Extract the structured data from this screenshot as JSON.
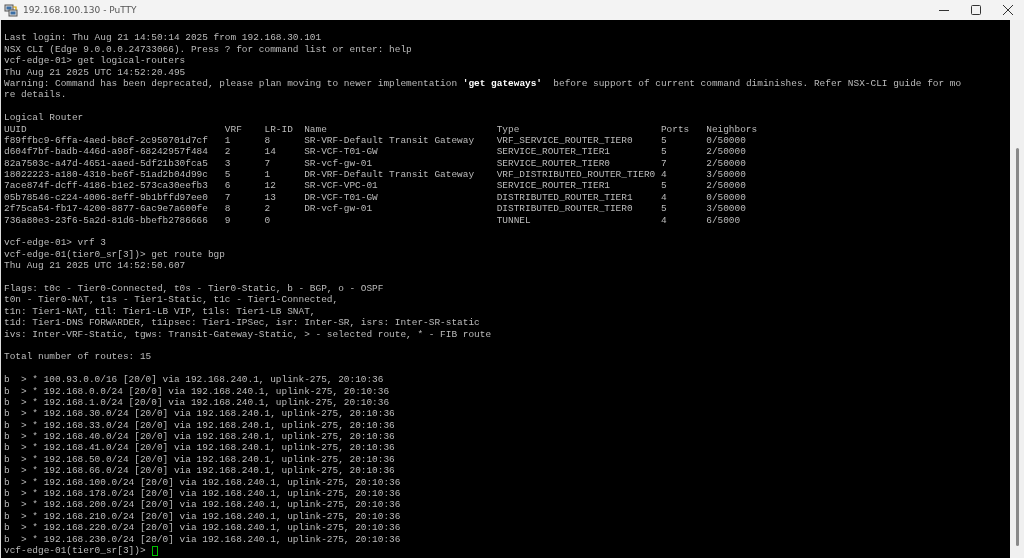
{
  "window": {
    "title": "192.168.100.130 - PuTTY"
  },
  "terminal": {
    "lines_before": [
      {
        "kind": "blank"
      },
      {
        "kind": "text",
        "text": "Last login: Thu Aug 21 14:50:14 2025 from 192.168.30.101"
      },
      {
        "kind": "text",
        "text": "NSX CLI (Edge 9.0.0.0.24733066). Press ? for command list or enter: help"
      },
      {
        "kind": "text",
        "text": "vcf-edge-01> get logical-routers"
      },
      {
        "kind": "text",
        "text": "Thu Aug 21 2025 UTC 14:52:20.495"
      },
      {
        "kind": "text",
        "text": "Warning: Command has been deprecated, please plan moving to newer implementation **'get gateways'**  before support of current command diminishes. Refer NSX-CLI guide for mo"
      },
      {
        "kind": "text",
        "text": "re details."
      },
      {
        "kind": "blank"
      },
      {
        "kind": "text",
        "text": "Logical Router"
      }
    ],
    "table": {
      "columns": [
        "UUID",
        "VRF",
        "LR-ID",
        "Name",
        "Type",
        "Ports",
        "Neighbors"
      ],
      "rows": [
        [
          "f89ffbc9-6ffa-4aed-b8cf-2c950701d7cf",
          "1",
          "8",
          "SR-VRF-Default Transit Gateway",
          "VRF_SERVICE_ROUTER_TIER0",
          "5",
          "0/50000"
        ],
        [
          "d604f7bf-badb-446d-a98f-68242957f484",
          "2",
          "14",
          "SR-VCF-T01-GW",
          "SERVICE_ROUTER_TIER1",
          "5",
          "2/50000"
        ],
        [
          "82a7503c-a47d-4651-aaed-5df21b30fca5",
          "3",
          "7",
          "SR-vcf-gw-01",
          "SERVICE_ROUTER_TIER0",
          "7",
          "2/50000"
        ],
        [
          "18022223-a180-4310-be6f-51ad2b04d99c",
          "5",
          "1",
          "DR-VRF-Default Transit Gateway",
          "VRF_DISTRIBUTED_ROUTER_TIER0",
          "4",
          "3/50000"
        ],
        [
          "7ace874f-dcff-4186-b1e2-573ca30eefb3",
          "6",
          "12",
          "SR-VCF-VPC-01",
          "SERVICE_ROUTER_TIER1",
          "5",
          "2/50000"
        ],
        [
          "05b78546-c224-4006-8eff-9b1bffd97ee0",
          "7",
          "13",
          "DR-VCF-T01-GW",
          "DISTRIBUTED_ROUTER_TIER1",
          "4",
          "0/50000"
        ],
        [
          "2f75ca54-fb17-4200-8877-6ac9e7a600fe",
          "8",
          "2",
          "DR-vcf-gw-01",
          "DISTRIBUTED_ROUTER_TIER0",
          "5",
          "3/50000"
        ],
        [
          "736a80e3-23f6-5a2d-81d6-bbefb2786666",
          "9",
          "0",
          "",
          "TUNNEL",
          "4",
          "6/5000"
        ]
      ]
    },
    "lines_after": [
      {
        "kind": "blank"
      },
      {
        "kind": "text",
        "text": "vcf-edge-01> vrf 3"
      },
      {
        "kind": "text",
        "text": "vcf-edge-01(tier0_sr[3])> get route bgp"
      },
      {
        "kind": "text",
        "text": "Thu Aug 21 2025 UTC 14:52:50.607"
      },
      {
        "kind": "blank"
      },
      {
        "kind": "text",
        "text": "Flags: t0c - Tier0-Connected, t0s - Tier0-Static, b - BGP, o - OSPF"
      },
      {
        "kind": "text",
        "text": "t0n - Tier0-NAT, t1s - Tier1-Static, t1c - Tier1-Connected,"
      },
      {
        "kind": "text",
        "text": "t1n: Tier1-NAT, t1l: Tier1-LB VIP, t1ls: Tier1-LB SNAT,"
      },
      {
        "kind": "text",
        "text": "t1d: Tier1-DNS FORWARDER, t1ipsec: Tier1-IPSec, isr: Inter-SR, isrs: Inter-SR-static"
      },
      {
        "kind": "text",
        "text": "ivs: Inter-VRF-Static, tgws: Transit-Gateway-Static, > - selected route, * - FIB route"
      },
      {
        "kind": "blank"
      },
      {
        "kind": "text",
        "text": "Total number of routes: 15"
      },
      {
        "kind": "blank"
      },
      {
        "kind": "text",
        "text": "b  > * 100.93.0.0/16 [20/0] via 192.168.240.1, uplink-275, 20:10:36"
      },
      {
        "kind": "text",
        "text": "b  > * 192.168.0.0/24 [20/0] via 192.168.240.1, uplink-275, 20:10:36"
      },
      {
        "kind": "text",
        "text": "b  > * 192.168.1.0/24 [20/0] via 192.168.240.1, uplink-275, 20:10:36"
      },
      {
        "kind": "text",
        "text": "b  > * 192.168.30.0/24 [20/0] via 192.168.240.1, uplink-275, 20:10:36"
      },
      {
        "kind": "text",
        "text": "b  > * 192.168.33.0/24 [20/0] via 192.168.240.1, uplink-275, 20:10:36"
      },
      {
        "kind": "text",
        "text": "b  > * 192.168.40.0/24 [20/0] via 192.168.240.1, uplink-275, 20:10:36"
      },
      {
        "kind": "text",
        "text": "b  > * 192.168.41.0/24 [20/0] via 192.168.240.1, uplink-275, 20:10:36"
      },
      {
        "kind": "text",
        "text": "b  > * 192.168.50.0/24 [20/0] via 192.168.240.1, uplink-275, 20:10:36"
      },
      {
        "kind": "text",
        "text": "b  > * 192.168.66.0/24 [20/0] via 192.168.240.1, uplink-275, 20:10:36"
      },
      {
        "kind": "text",
        "text": "b  > * 192.168.100.0/24 [20/0] via 192.168.240.1, uplink-275, 20:10:36"
      },
      {
        "kind": "text",
        "text": "b  > * 192.168.178.0/24 [20/0] via 192.168.240.1, uplink-275, 20:10:36"
      },
      {
        "kind": "text",
        "text": "b  > * 192.168.200.0/24 [20/0] via 192.168.240.1, uplink-275, 20:10:36"
      },
      {
        "kind": "text",
        "text": "b  > * 192.168.210.0/24 [20/0] via 192.168.240.1, uplink-275, 20:10:36"
      },
      {
        "kind": "text",
        "text": "b  > * 192.168.220.0/24 [20/0] via 192.168.240.1, uplink-275, 20:10:36"
      },
      {
        "kind": "text",
        "text": "b  > * 192.168.230.0/24 [20/0] via 192.168.240.1, uplink-275, 20:10:36"
      },
      {
        "kind": "prompt",
        "text": "vcf-edge-01(tier0_sr[3])>"
      }
    ]
  }
}
